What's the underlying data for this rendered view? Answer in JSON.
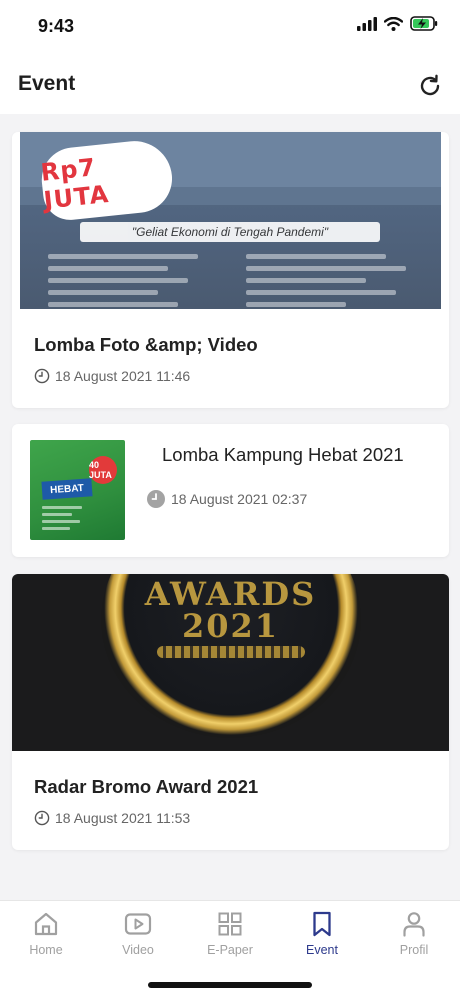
{
  "status_bar": {
    "time": "9:43",
    "icons": [
      "signal-icon",
      "wifi-icon",
      "battery-charging-icon"
    ]
  },
  "header": {
    "title": "Event",
    "refresh_icon": "refresh-icon"
  },
  "events": [
    {
      "title": "Lomba Foto &amp; Video",
      "date": "18 August 2021 11:46",
      "banner_headline": "Rp7 JUTA",
      "banner_tagline": "\"Geliat Ekonomi di Tengah Pandemi\""
    },
    {
      "title": "Lomba Kampung Hebat 2021",
      "date": "18 August 2021 02:37",
      "thumb_badge": "40 JUTA",
      "thumb_word": "HEBAT"
    },
    {
      "title": "Radar Bromo Award 2021",
      "date": "18 August 2021 11:53",
      "banner_text_1": "AWARDS",
      "banner_text_2": "2021"
    }
  ],
  "bottom_nav": {
    "active": "Event",
    "active_color": "#2d3a8c",
    "inactive_color": "#a0a0a0",
    "items": [
      {
        "label": "Home",
        "icon": "home-icon"
      },
      {
        "label": "Video",
        "icon": "video-icon"
      },
      {
        "label": "E-Paper",
        "icon": "grid-icon"
      },
      {
        "label": "Event",
        "icon": "bookmark-icon"
      },
      {
        "label": "Profil",
        "icon": "user-icon"
      }
    ]
  }
}
